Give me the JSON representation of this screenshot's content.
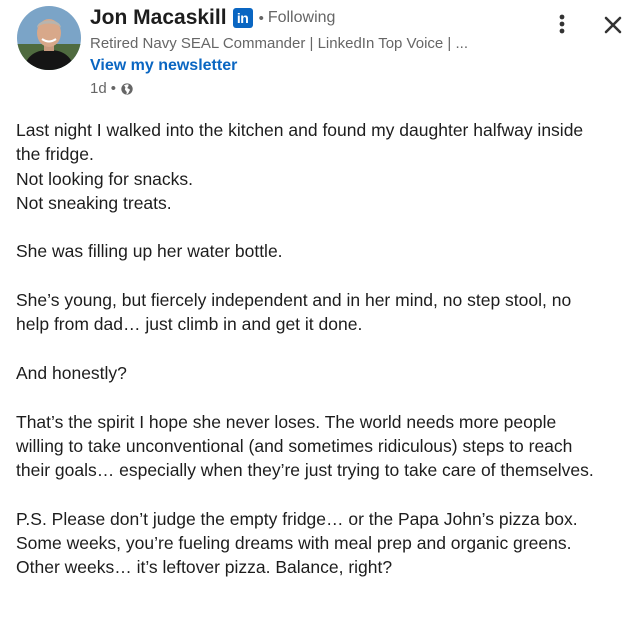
{
  "author": {
    "name": "Jon Macaskill",
    "badge": "in",
    "follow_status": "Following",
    "separator": "•",
    "headline": "Retired Navy SEAL Commander | LinkedIn Top Voice | ...",
    "newsletter_link": "View my newsletter",
    "time_ago": "1d",
    "visibility_icon": "globe-icon"
  },
  "actions": {
    "more_icon": "more-vertical-icon",
    "close_icon": "close-icon"
  },
  "post": {
    "lines": [
      "Last night I walked into the kitchen and found my daughter halfway inside",
      "the fridge.",
      "Not looking for snacks.",
      "Not sneaking treats.",
      "",
      "She was filling up her water bottle.",
      "",
      "She’s young, but fiercely independent and in her mind, no step stool, no",
      "help from dad… just climb in and get it done.",
      "",
      "And honestly?",
      "",
      "That’s the spirit I hope she never loses. The world needs more people",
      "willing to take unconventional (and sometimes ridiculous) steps to reach",
      "their goals… especially when they’re just trying to take care of themselves.",
      "",
      "P.S. Please don’t judge the empty fridge… or the Papa John’s pizza box.",
      "Some weeks, you’re fueling dreams with meal prep and organic greens.",
      "Other weeks… it’s leftover pizza. Balance, right?"
    ]
  },
  "colors": {
    "link_blue": "#0a66c2",
    "text_primary": "#1d1d1d",
    "text_secondary": "#666666"
  }
}
